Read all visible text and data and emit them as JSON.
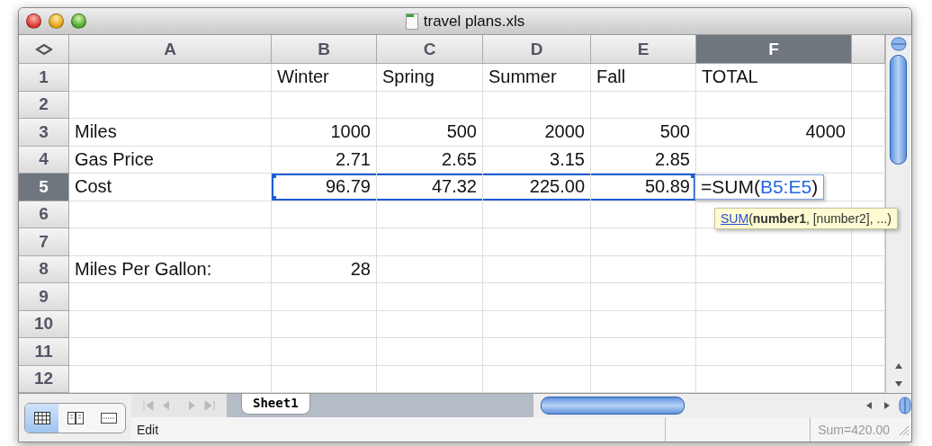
{
  "window": {
    "title": "travel plans.xls"
  },
  "columns": [
    {
      "label": "A",
      "selected": false
    },
    {
      "label": "B",
      "selected": false
    },
    {
      "label": "C",
      "selected": false
    },
    {
      "label": "D",
      "selected": false
    },
    {
      "label": "E",
      "selected": false
    },
    {
      "label": "F",
      "selected": true
    }
  ],
  "rows": [
    {
      "number": "1",
      "selected": false,
      "kind": "labels",
      "cells": [
        {
          "selected": false
        },
        {
          "text": "Winter",
          "selected": false
        },
        {
          "text": "Spring",
          "selected": false
        },
        {
          "text": "Summer",
          "selected": false
        },
        {
          "text": "Fall",
          "selected": false
        },
        {
          "text": "TOTAL",
          "selected": false
        }
      ]
    },
    {
      "number": "2",
      "selected": false,
      "kind": "data",
      "cells": [
        {
          "selected": false
        },
        {
          "selected": false
        },
        {
          "selected": false
        },
        {
          "selected": false
        },
        {
          "selected": false
        },
        {
          "selected": false
        }
      ]
    },
    {
      "number": "3",
      "selected": false,
      "kind": "data",
      "cells": [
        {
          "text": "Miles",
          "selected": false
        },
        {
          "text": "1000",
          "selected": false
        },
        {
          "text": "500",
          "selected": false
        },
        {
          "text": "2000",
          "selected": false
        },
        {
          "text": "500",
          "selected": false
        },
        {
          "text": "4000",
          "selected": false
        }
      ]
    },
    {
      "number": "4",
      "selected": false,
      "kind": "data",
      "cells": [
        {
          "text": "Gas Price",
          "selected": false
        },
        {
          "text": "2.71",
          "selected": false
        },
        {
          "text": "2.65",
          "selected": false
        },
        {
          "text": "3.15",
          "selected": false
        },
        {
          "text": "2.85",
          "selected": false
        },
        {
          "selected": false
        }
      ]
    },
    {
      "number": "5",
      "selected": true,
      "kind": "data",
      "cells": [
        {
          "text": "Cost",
          "selected": false
        },
        {
          "text": "96.79",
          "selected": true
        },
        {
          "text": "47.32",
          "selected": true
        },
        {
          "text": "225.00",
          "selected": true
        },
        {
          "text": "50.89",
          "selected": true
        },
        {
          "selected": false,
          "editor": {
            "prefix": "=SUM(",
            "reference": "B5:E5",
            "suffix": ")",
            "tooltip": {
              "function": "SUM",
              "arguments": "(**number1**, [number2], ...)"
            }
          }
        }
      ]
    },
    {
      "number": "6",
      "selected": false,
      "kind": "data",
      "cells": [
        {
          "selected": false
        },
        {
          "selected": false
        },
        {
          "selected": false
        },
        {
          "selected": false
        },
        {
          "selected": false
        },
        {
          "selected": false
        }
      ]
    },
    {
      "number": "7",
      "selected": false,
      "kind": "data",
      "cells": [
        {
          "selected": false
        },
        {
          "selected": false
        },
        {
          "selected": false
        },
        {
          "selected": false
        },
        {
          "selected": false
        },
        {
          "selected": false
        }
      ]
    },
    {
      "number": "8",
      "selected": false,
      "kind": "data",
      "cells": [
        {
          "text": "Miles Per Gallon:",
          "selected": false
        },
        {
          "text": "28",
          "selected": false
        },
        {
          "selected": false
        },
        {
          "selected": false
        },
        {
          "selected": false
        },
        {
          "selected": false
        }
      ]
    },
    {
      "number": "9",
      "selected": false,
      "kind": "data",
      "cells": [
        {
          "selected": false
        },
        {
          "selected": false
        },
        {
          "selected": false
        },
        {
          "selected": false
        },
        {
          "selected": false
        },
        {
          "selected": false
        }
      ]
    },
    {
      "number": "10",
      "selected": false,
      "kind": "data",
      "cells": [
        {
          "selected": false
        },
        {
          "selected": false
        },
        {
          "selected": false
        },
        {
          "selected": false
        },
        {
          "selected": false
        },
        {
          "selected": false
        }
      ]
    },
    {
      "number": "11",
      "selected": false,
      "kind": "data",
      "cells": [
        {
          "selected": false
        },
        {
          "selected": false
        },
        {
          "selected": false
        },
        {
          "selected": false
        },
        {
          "selected": false
        },
        {
          "selected": false
        }
      ]
    },
    {
      "number": "12",
      "selected": false,
      "kind": "data",
      "cells": [
        {
          "selected": false
        },
        {
          "selected": false
        },
        {
          "selected": false
        },
        {
          "selected": false
        },
        {
          "selected": false
        },
        {
          "selected": false
        }
      ]
    }
  ],
  "view_buttons": [
    {
      "kind": "normal",
      "selected": true
    },
    {
      "kind": "page-layout",
      "selected": false
    },
    {
      "kind": "page-break",
      "selected": false
    }
  ],
  "sheet_tabs": [
    {
      "label": "Sheet1",
      "selected": true
    }
  ],
  "status_bar": {
    "mode": "Edit",
    "sum": "Sum=420.00"
  }
}
